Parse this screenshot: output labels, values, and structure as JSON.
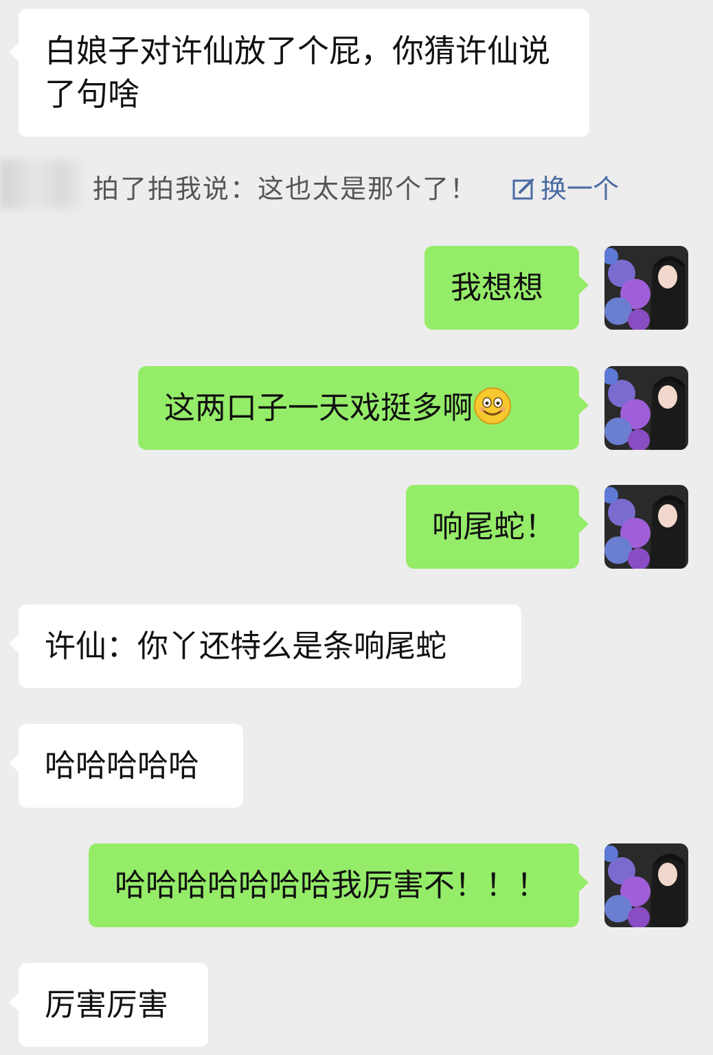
{
  "messages": [
    {
      "side": "in",
      "text": "白娘子对许仙放了个屁，你猜许仙说了句啥"
    },
    {
      "side": "system",
      "pat_text": "拍了拍我说：这也太是那个了！",
      "action_label": "换一个",
      "action_icon": "edit-icon"
    },
    {
      "side": "out",
      "text": "我想想"
    },
    {
      "side": "out",
      "text": "这两口子一天戏挺多啊",
      "emoji": "smile-emoji"
    },
    {
      "side": "out",
      "text": "响尾蛇！"
    },
    {
      "side": "in",
      "text": "许仙：你丫还特么是条响尾蛇"
    },
    {
      "side": "in",
      "text": "哈哈哈哈哈"
    },
    {
      "side": "out",
      "text": "哈哈哈哈哈哈哈我厉害不！！！"
    },
    {
      "side": "in",
      "text": "厉害厉害"
    }
  ],
  "colors": {
    "background": "#ededed",
    "incoming_bubble": "#ffffff",
    "outgoing_bubble": "#95ec69",
    "system_text": "#555555",
    "link": "#4a6aa3"
  }
}
